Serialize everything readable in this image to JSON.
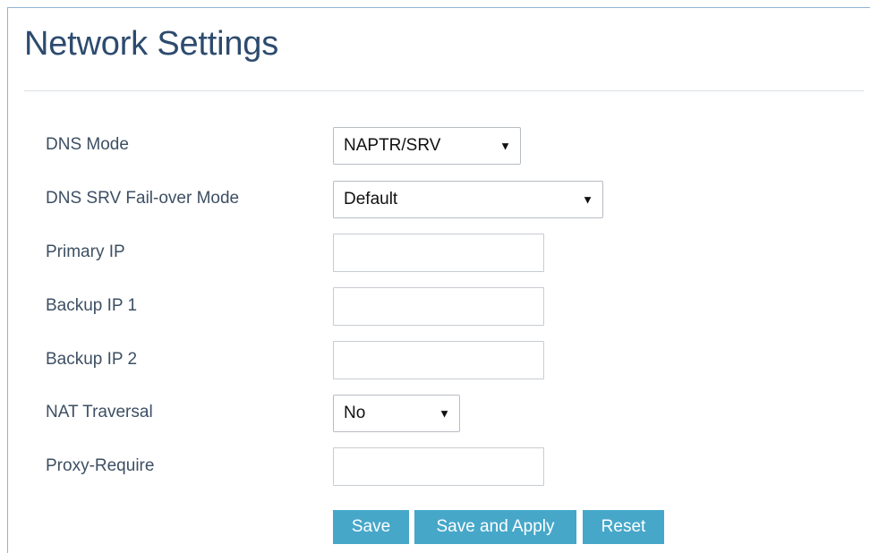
{
  "page": {
    "title": "Network Settings"
  },
  "form": {
    "dns_mode": {
      "label": "DNS Mode",
      "value": "NAPTR/SRV"
    },
    "dns_srv_failover": {
      "label": "DNS SRV Fail-over Mode",
      "value": "Default"
    },
    "primary_ip": {
      "label": "Primary IP",
      "value": ""
    },
    "backup_ip_1": {
      "label": "Backup IP 1",
      "value": ""
    },
    "backup_ip_2": {
      "label": "Backup IP 2",
      "value": ""
    },
    "nat_traversal": {
      "label": "NAT Traversal",
      "value": "No"
    },
    "proxy_require": {
      "label": "Proxy-Require",
      "value": ""
    }
  },
  "buttons": {
    "save": "Save",
    "save_apply": "Save and Apply",
    "reset": "Reset"
  },
  "icons": {
    "dropdown": "caret-down-icon"
  },
  "colors": {
    "title": "#2d4b6e",
    "label": "#3d4f63",
    "button_bg": "#46a7c9",
    "button_text": "#ffffff",
    "frame_border": "#8fb4d6"
  }
}
